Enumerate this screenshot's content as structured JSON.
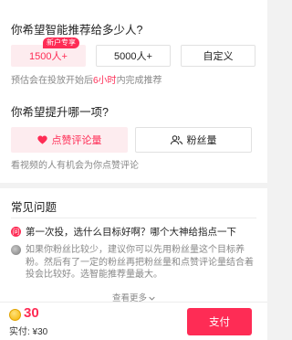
{
  "audience": {
    "title": "你希望智能推荐给多少人?",
    "options": [
      {
        "label": "1500人+",
        "badge": "新户专享",
        "selected": true
      },
      {
        "label": "5000人+",
        "selected": false
      },
      {
        "label": "自定义",
        "selected": false
      }
    ],
    "hint_prefix": "预估会在投放开始后",
    "hint_highlight": "6小时",
    "hint_suffix": "内完成推荐"
  },
  "goal": {
    "title": "你希望提升哪一项?",
    "options": [
      {
        "label": "点赞评论量",
        "icon": "heart-icon",
        "selected": true
      },
      {
        "label": "粉丝量",
        "icon": "users-icon",
        "selected": false
      }
    ],
    "hint": "看视频的人有机会为你点赞评论"
  },
  "faq": {
    "title": "常见问题",
    "question": "第一次投，选什么目标好啊？哪个大神给指点一下",
    "question_icon_text": "问",
    "answer": "如果你粉丝比较少，建议你可以先用粉丝量这个目标养粉。然后有了一定的粉丝再把粉丝量和点赞评论量结合着投会比较好。选智能推荐量最大。",
    "more": "查看更多"
  },
  "footer": {
    "price": "30",
    "paid_label": "实付: ¥30",
    "pay_button": "支付"
  },
  "colors": {
    "accent": "#fe2c55",
    "accent_bg": "#fdecef"
  }
}
